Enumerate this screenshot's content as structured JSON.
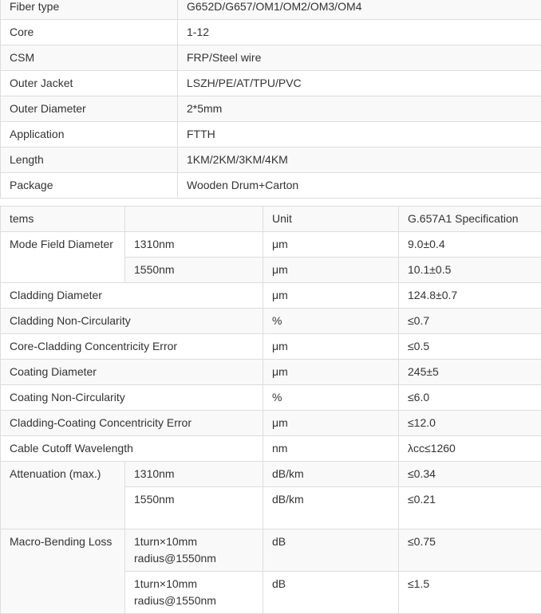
{
  "spec_table": {
    "rows": [
      {
        "label": "Fiber type",
        "value": "G652D/G657/OM1/OM2/OM3/OM4"
      },
      {
        "label": "Core",
        "value": "1-12"
      },
      {
        "label": "CSM",
        "value": "FRP/Steel wire"
      },
      {
        "label": "Outer Jacket",
        "value": "LSZH/PE/AT/TPU/PVC"
      },
      {
        "label": "Outer Diameter",
        "value": "2*5mm"
      },
      {
        "label": "Application",
        "value": "FTTH"
      },
      {
        "label": "Length",
        "value": "1KM/2KM/3KM/4KM"
      },
      {
        "label": "Package",
        "value": "Wooden Drum+Carton"
      }
    ]
  },
  "fiber_table": {
    "header": {
      "items": "tems",
      "sub": "",
      "unit": "Unit",
      "spec": "G.657A1 Specification"
    },
    "mode_field": {
      "label": "Mode Field Diameter",
      "rows": [
        {
          "sub": "1310nm",
          "unit": "μm",
          "spec": "9.0±0.4"
        },
        {
          "sub": "1550nm",
          "unit": "μm",
          "spec": "10.1±0.5"
        }
      ]
    },
    "simple_rows": [
      {
        "label": "Cladding Diameter",
        "unit": "μm",
        "spec": "124.8±0.7"
      },
      {
        "label": "Cladding Non-Circularity",
        "unit": "%",
        "spec": "≤0.7"
      },
      {
        "label": "Core-Cladding Concentricity Error",
        "unit": "μm",
        "spec": "≤0.5"
      },
      {
        "label": "Coating Diameter",
        "unit": "μm",
        "spec": "245±5"
      },
      {
        "label": "Coating Non-Circularity",
        "unit": "%",
        "spec": "≤6.0"
      },
      {
        "label": "Cladding-Coating Concentricity Error",
        "unit": "μm",
        "spec": "≤12.0"
      },
      {
        "label": "Cable Cutoff Wavelength",
        "unit": "nm",
        "spec": "λcc≤1260"
      }
    ],
    "attenuation": {
      "label": "Attenuation (max.)",
      "rows": [
        {
          "sub": "1310nm",
          "unit": "dB/km",
          "spec": "≤0.34"
        },
        {
          "sub": "1550nm",
          "unit": "dB/km",
          "spec": "≤0.21"
        }
      ]
    },
    "macro_bending": {
      "label": "Macro-Bending Loss",
      "rows": [
        {
          "sub": "1turn×10mm radius@1550nm",
          "unit": "dB",
          "spec": "≤0.75"
        },
        {
          "sub": "1turn×10mm radius@1550nm",
          "unit": "dB",
          "spec": "≤1.5"
        }
      ]
    }
  }
}
